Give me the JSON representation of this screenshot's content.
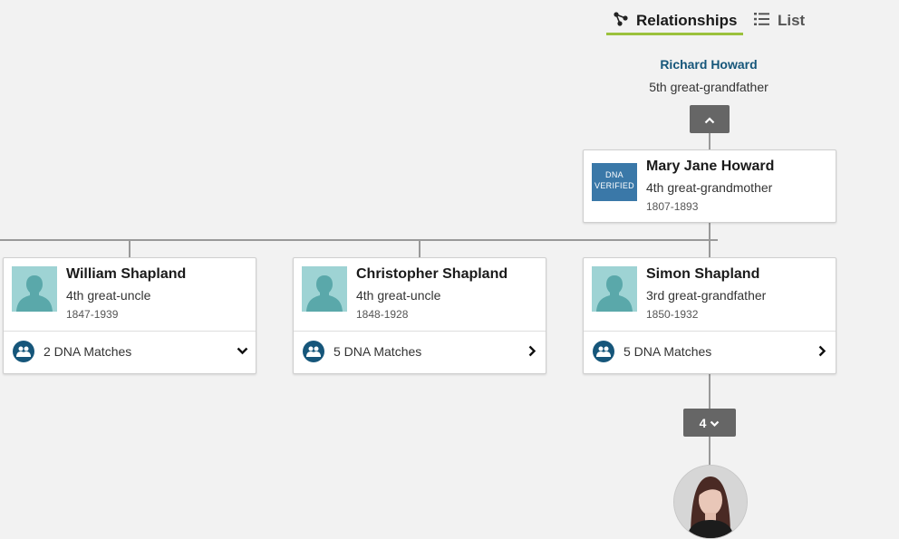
{
  "view_toggle": {
    "relationships_label": "Relationships",
    "list_label": "List",
    "active": "relationships",
    "accent_color": "#9bc13c"
  },
  "top_ancestor": {
    "name": "Richard Howard",
    "relationship": "5th great-grandfather"
  },
  "expand_up_icon": "chevron-up-icon",
  "parent_card": {
    "name": "Mary Jane Howard",
    "relationship": "4th great-grandmother",
    "dates": "1807-1893",
    "badge_line1": "DNA",
    "badge_line2": "VERIFIED"
  },
  "children": [
    {
      "name": "William Shapland",
      "relationship": "4th great-uncle",
      "dates": "1847-1939",
      "dna_matches": "2 DNA Matches",
      "chevron": "chevron-down-icon"
    },
    {
      "name": "Christopher Shapland",
      "relationship": "4th great-uncle",
      "dates": "1848-1928",
      "dna_matches": "5 DNA Matches",
      "chevron": "chevron-right-icon"
    },
    {
      "name": "Simon Shapland",
      "relationship": "3rd great-grandfather",
      "dates": "1850-1932",
      "dna_matches": "5 DNA Matches",
      "chevron": "chevron-right-icon"
    }
  ],
  "generations_button": {
    "count": "4",
    "icon": "chevron-down-icon"
  },
  "colors": {
    "link_blue": "#16567a",
    "photo_bg": "#9ed3d4",
    "silhouette": "#5aa8aa",
    "button_gray": "#666666"
  }
}
